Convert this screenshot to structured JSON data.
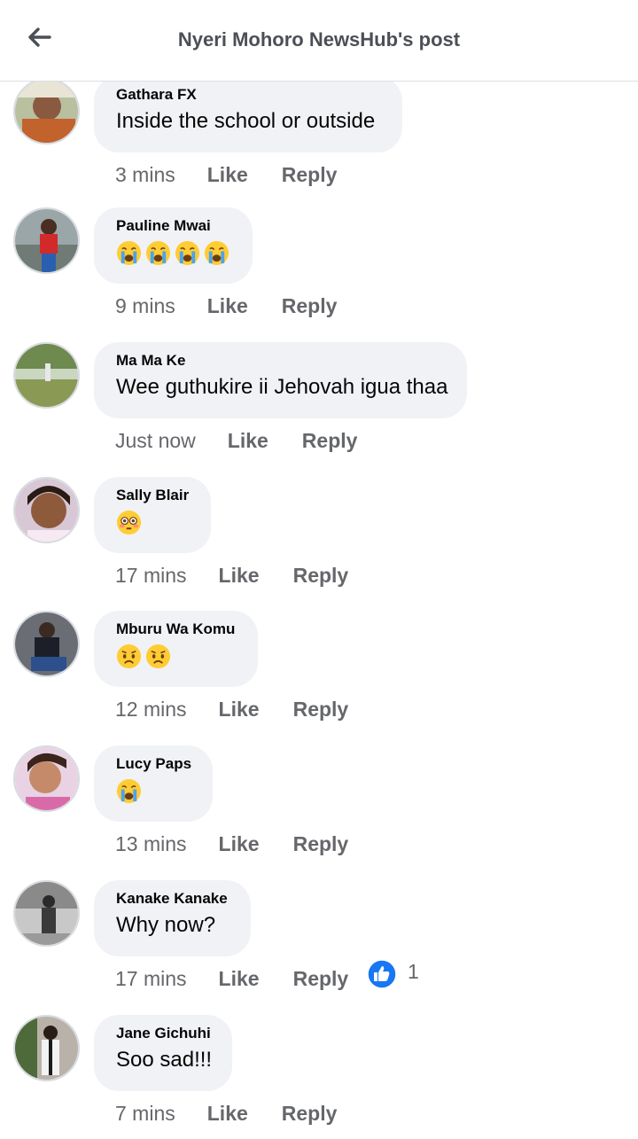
{
  "header": {
    "title": "Nyeri Mohoro NewsHub's post",
    "back_icon": "arrow-left-icon"
  },
  "actions": {
    "like": "Like",
    "reply": "Reply"
  },
  "colors": {
    "bubble": "#f0f2f5",
    "meta": "#65676b",
    "like_blue": "#1877f2"
  },
  "comments": [
    {
      "author": "Gathara FX",
      "text": "Inside the school or outside",
      "time": "3 mins",
      "emojis": []
    },
    {
      "author": "Pauline Mwai",
      "text": "",
      "time": "9 mins",
      "emojis": [
        "loudly-crying-face",
        "loudly-crying-face",
        "loudly-crying-face",
        "loudly-crying-face"
      ]
    },
    {
      "author": "Ma Ma Ke",
      "text": "Wee guthukire ii Jehovah igua thaa",
      "time": "Just now",
      "emojis": []
    },
    {
      "author": "Sally Blair",
      "text": "",
      "time": "17 mins",
      "emojis": [
        "flushed-face"
      ]
    },
    {
      "author": "Mburu Wa Komu",
      "text": "",
      "time": "12 mins",
      "emojis": [
        "worried-face",
        "worried-face"
      ]
    },
    {
      "author": "Lucy Paps",
      "text": "",
      "time": "13 mins",
      "emojis": [
        "loudly-crying-face"
      ]
    },
    {
      "author": "Kanake Kanake",
      "text": "Why now?",
      "time": "17 mins",
      "emojis": [],
      "reaction": {
        "icon": "thumbs-up-icon",
        "count": "1"
      }
    },
    {
      "author": "Jane Gichuhi",
      "text": "Soo sad!!!",
      "time": "7 mins",
      "emojis": []
    }
  ]
}
